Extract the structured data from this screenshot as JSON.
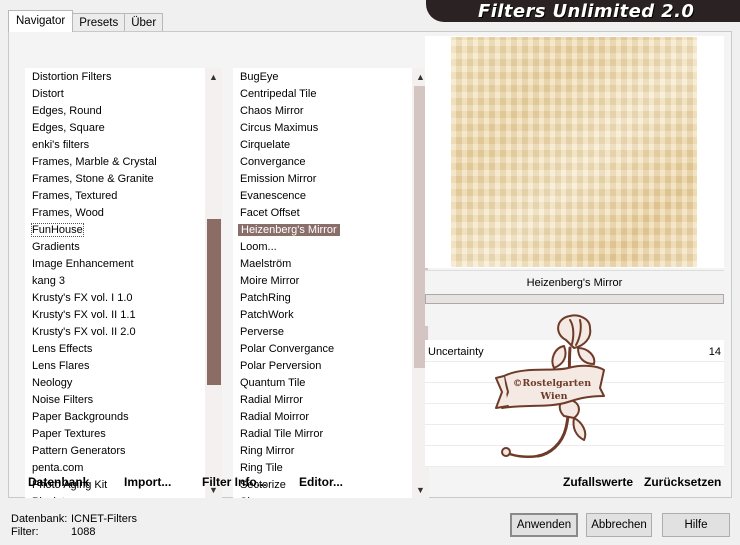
{
  "tabs": [
    {
      "label": "Navigator",
      "active": true
    },
    {
      "label": "Presets",
      "active": false
    },
    {
      "label": "Über",
      "active": false
    }
  ],
  "title": "Filters Unlimited 2.0",
  "categories": {
    "items": [
      "Distortion Filters",
      "Distort",
      "Edges, Round",
      "Edges, Square",
      "enki's filters",
      "Frames, Marble & Crystal",
      "Frames, Stone & Granite",
      "Frames, Textured",
      "Frames, Wood",
      "FunHouse",
      "Gradients",
      "Image Enhancement",
      "kang 3",
      "Krusty's FX vol. I 1.0",
      "Krusty's FX vol. II 1.1",
      "Krusty's FX vol. II 2.0",
      "Lens Effects",
      "Lens Flares",
      "Neology",
      "Noise Filters",
      "Paper Backgrounds",
      "Paper Textures",
      "Pattern Generators",
      "penta.com",
      "Photo Aging Kit",
      "Pixelate"
    ],
    "active": "FunHouse"
  },
  "filters": {
    "items": [
      "BugEye",
      "Centripedal Tile",
      "Chaos Mirror",
      "Circus Maximus",
      "Cirquelate",
      "Convergance",
      "Emission Mirror",
      "Evanescence",
      "Facet Offset",
      "Heizenberg's Mirror",
      "Loom...",
      "Maelström",
      "Moire Mirror",
      "PatchRing",
      "PatchWork",
      "Perverse",
      "Polar Convergance",
      "Polar Perversion",
      "Quantum Tile",
      "Radial Mirror",
      "Radial Moirror",
      "Radial Tile Mirror",
      "Ring Mirror",
      "Ring Tile",
      "Sectorize",
      "Shapes"
    ],
    "selected": "Heizenberg's Mirror"
  },
  "scroll_icons": {
    "up": "▲",
    "down": "▼"
  },
  "preview": {
    "filter_name": "Heizenberg's Mirror"
  },
  "params": [
    {
      "label": "Uncertainty",
      "value": "14"
    }
  ],
  "toolbar": {
    "datenbank": "Datenbank",
    "import": "Import...",
    "filter_info": "Filter Info...",
    "editor": "Editor...",
    "zufallswerte": "Zufallswerte",
    "zuruecksetzen": "Zurücksetzen"
  },
  "status": {
    "datenbank_label": "Datenbank:",
    "datenbank_value": "ICNET-Filters",
    "filter_label": "Filter:",
    "filter_value": "1088"
  },
  "buttons": {
    "apply": "Anwenden",
    "cancel": "Abbrechen",
    "help": "Hilfe"
  },
  "watermark": {
    "line1": "©Rostelgarten",
    "line2": "Wien"
  },
  "colors": {
    "selection": "#8a6e6a",
    "banner": "#2b2323",
    "scroll_thumb": "#8c6d65",
    "watermark": "#6e3b28"
  }
}
